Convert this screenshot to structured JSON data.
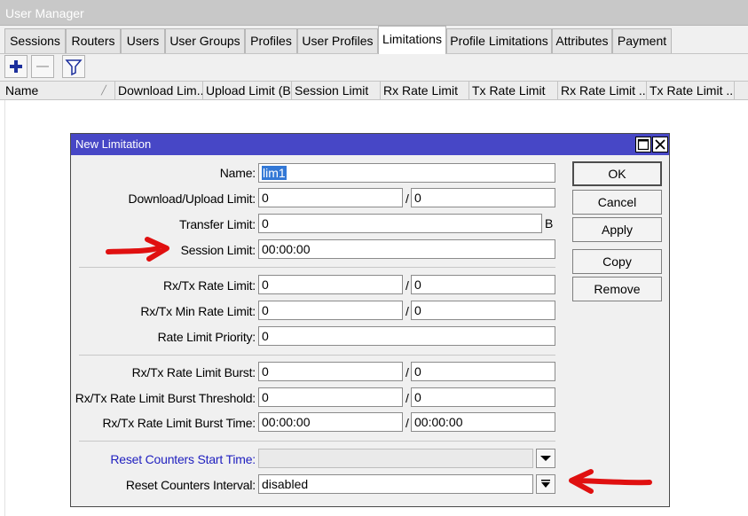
{
  "window": {
    "title": "User Manager"
  },
  "tabs": [
    "Sessions",
    "Routers",
    "Users",
    "User Groups",
    "Profiles",
    "User Profiles",
    "Limitations",
    "Profile Limitations",
    "Attributes",
    "Payment"
  ],
  "active_tab": "Limitations",
  "toolbar": {
    "add_icon": "plus-icon",
    "remove_icon": "minus-icon",
    "filter_icon": "filter-icon"
  },
  "columns": [
    "Name",
    "Download Lim...",
    "Upload Limit (B)",
    "Session Limit",
    "Rx Rate Limit",
    "Tx Rate Limit",
    "Rx Rate Limit ...",
    "Tx Rate Limit ..."
  ],
  "dialog": {
    "title": "New Limitation",
    "fields": {
      "name": {
        "label": "Name:",
        "value": "lim1"
      },
      "download_upload_limit": {
        "label": "Download/Upload Limit:",
        "value1": "0",
        "value2": "0"
      },
      "transfer_limit": {
        "label": "Transfer Limit:",
        "value": "0",
        "unit": "B"
      },
      "session_limit": {
        "label": "Session Limit:",
        "value": "00:00:00"
      },
      "rx_tx_rate_limit": {
        "label": "Rx/Tx Rate Limit:",
        "value1": "0",
        "value2": "0"
      },
      "rx_tx_min_rate_limit": {
        "label": "Rx/Tx Min Rate Limit:",
        "value1": "0",
        "value2": "0"
      },
      "rate_limit_priority": {
        "label": "Rate Limit Priority:",
        "value": "0"
      },
      "rx_tx_rate_limit_burst": {
        "label": "Rx/Tx Rate Limit Burst:",
        "value1": "0",
        "value2": "0"
      },
      "rx_tx_rate_limit_burst_threshold": {
        "label": "Rx/Tx Rate Limit Burst Threshold:",
        "value1": "0",
        "value2": "0"
      },
      "rx_tx_rate_limit_burst_time": {
        "label": "Rx/Tx Rate Limit Burst Time:",
        "value1": "00:00:00",
        "value2": "00:00:00"
      },
      "reset_counters_start_time": {
        "label": "Reset Counters Start Time:",
        "value": ""
      },
      "reset_counters_interval": {
        "label": "Reset Counters Interval:",
        "value": "disabled"
      }
    },
    "separator": "/",
    "buttons": {
      "ok": "OK",
      "cancel": "Cancel",
      "apply": "Apply",
      "copy": "Copy",
      "remove": "Remove"
    }
  },
  "colors": {
    "dialog_title_bar": "#4747c6",
    "annotation_arrow": "#e01010",
    "link_label": "#1f1fbf",
    "selection": "#3378d6"
  }
}
